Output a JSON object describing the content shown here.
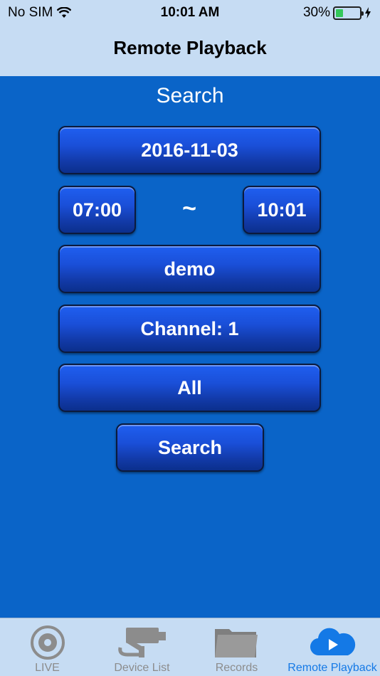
{
  "status_bar": {
    "carrier": "No SIM",
    "time": "10:01 AM",
    "battery": "30%",
    "battery_level": 0.3
  },
  "nav": {
    "title": "Remote Playback"
  },
  "main": {
    "heading": "Search",
    "date": "2016-11-03",
    "start_time": "07:00",
    "separator": "~",
    "end_time": "10:01",
    "device": "demo",
    "channel": "Channel:  1",
    "record_type": "All",
    "search_label": "Search"
  },
  "tabs": [
    {
      "label": "LIVE",
      "icon": "live-disc-icon"
    },
    {
      "label": "Device List",
      "icon": "camera-icon"
    },
    {
      "label": "Records",
      "icon": "folder-icon"
    },
    {
      "label": "Remote Playback",
      "icon": "cloud-play-icon"
    }
  ],
  "colors": {
    "background": "#0a64c8",
    "bar": "#c6dcf3",
    "active_tab": "#1479e6"
  }
}
